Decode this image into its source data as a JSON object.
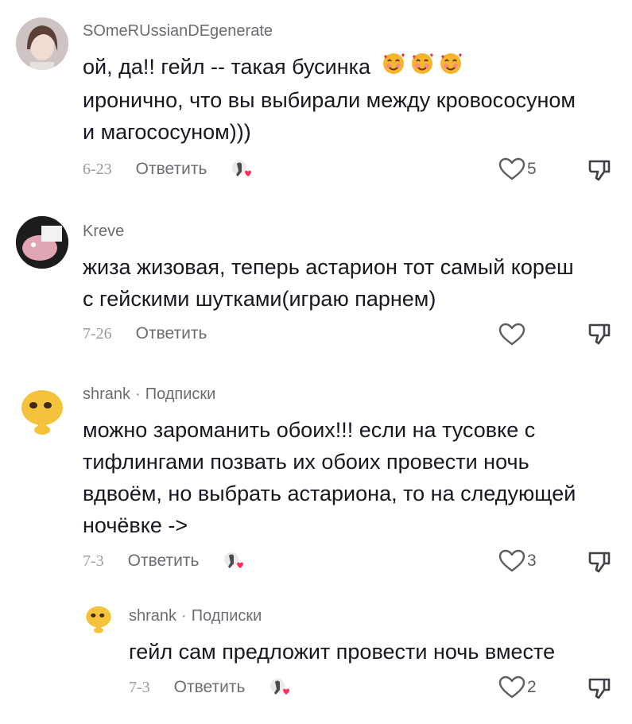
{
  "comments": [
    {
      "username": "SOmeRUssianDEgenerate",
      "text_lines": [
        "ой, да!! гейл -- такая бусинка",
        "иронично, что вы выбирали между кровососуном",
        "и магососуном)))"
      ],
      "date": "6-23",
      "reply_label": "Ответить",
      "likes": "5"
    },
    {
      "username": "Kreve",
      "text_lines": [
        "жиза жизовая, теперь астарион тот самый кореш",
        "с гейскими шутками(играю парнем)"
      ],
      "date": "7-26",
      "reply_label": "Ответить",
      "likes": ""
    },
    {
      "username": "shrank",
      "badge": "Подписки",
      "separator": "·",
      "text_lines": [
        "можно зароманить обоих!!! если на тусовке с",
        "тифлингами позвать их обоих провести ночь",
        "вдвоём, но выбрать астариона, то на следующей",
        "ночёвке ->"
      ],
      "date": "7-3",
      "reply_label": "Ответить",
      "likes": "3"
    },
    {
      "username": "shrank",
      "badge": "Подписки",
      "separator": "·",
      "text_lines": [
        "гейл сам предложит провести ночь вместе"
      ],
      "date": "7-3",
      "reply_label": "Ответить",
      "likes": "2"
    }
  ],
  "icons": {
    "like": "heart-outline-icon",
    "dislike": "thumbs-down-icon",
    "creator_like": "creator-liked-icon",
    "emoji": "smiling-face-with-hearts-icon"
  },
  "colors": {
    "text": "#161823",
    "muted": "#8a8b91",
    "heart_red": "#fe2c55",
    "emoji_yellow": "#f7b52c"
  }
}
